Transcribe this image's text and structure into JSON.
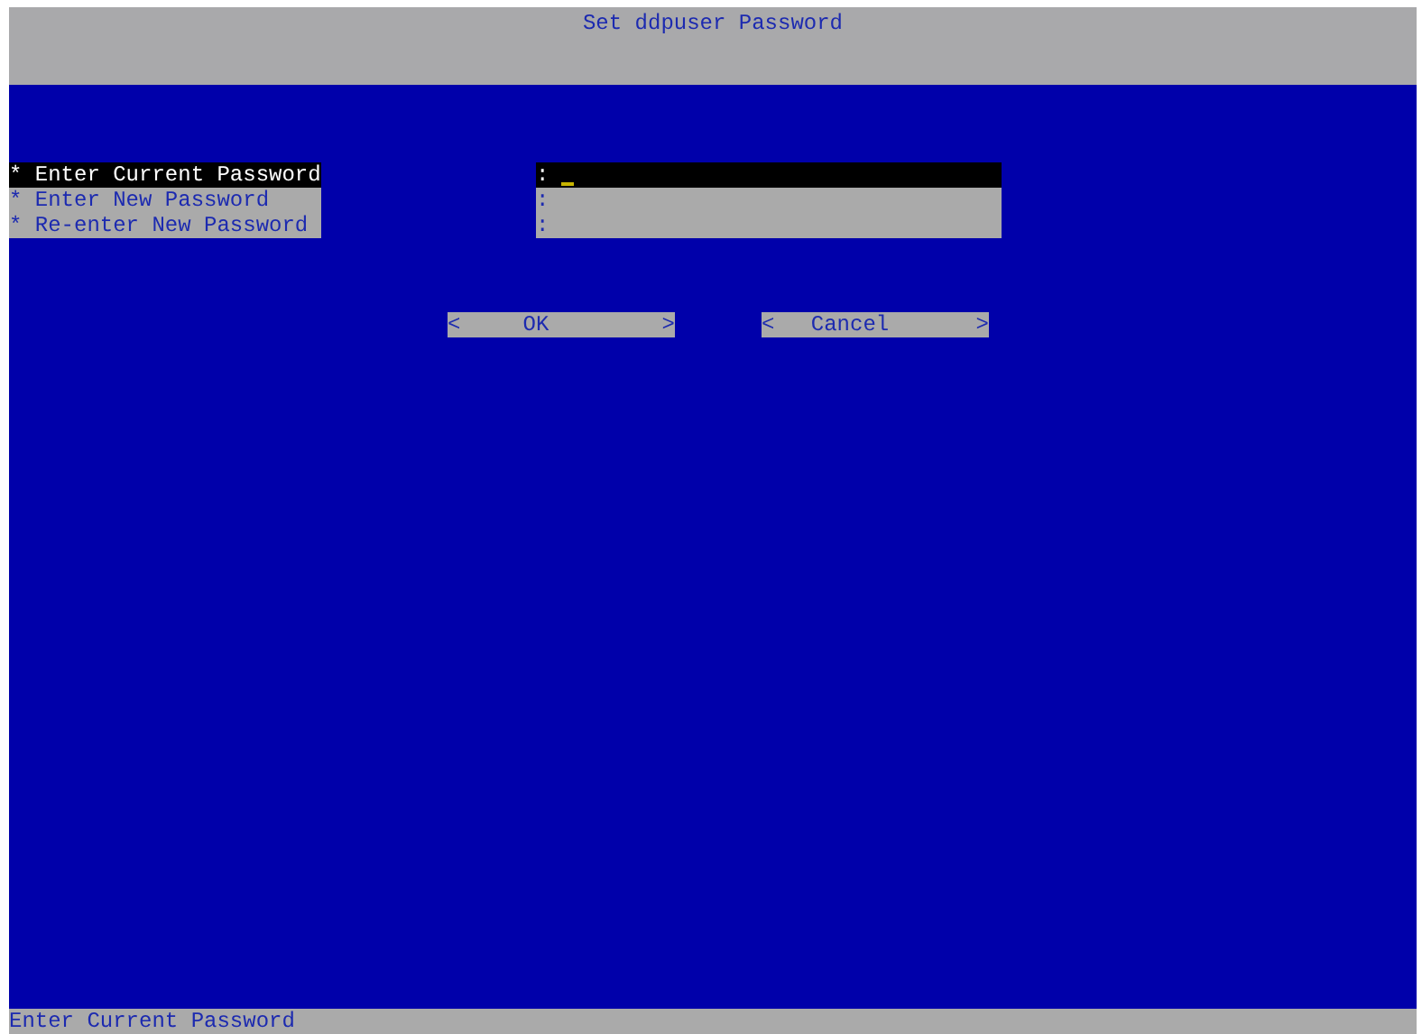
{
  "window": {
    "title": "Set ddpuser Password"
  },
  "fields": [
    {
      "label": "* Enter Current Password",
      "separator": ":",
      "selected": true
    },
    {
      "label": "* Enter New Password",
      "separator": ":",
      "selected": false
    },
    {
      "label": "* Re-enter New Password",
      "separator": ":",
      "selected": false
    }
  ],
  "buttons": [
    {
      "left": "<",
      "label": "OK",
      "right": ">"
    },
    {
      "left": "<",
      "label": "Cancel",
      "right": ">"
    }
  ],
  "status_bar": "Enter Current Password"
}
